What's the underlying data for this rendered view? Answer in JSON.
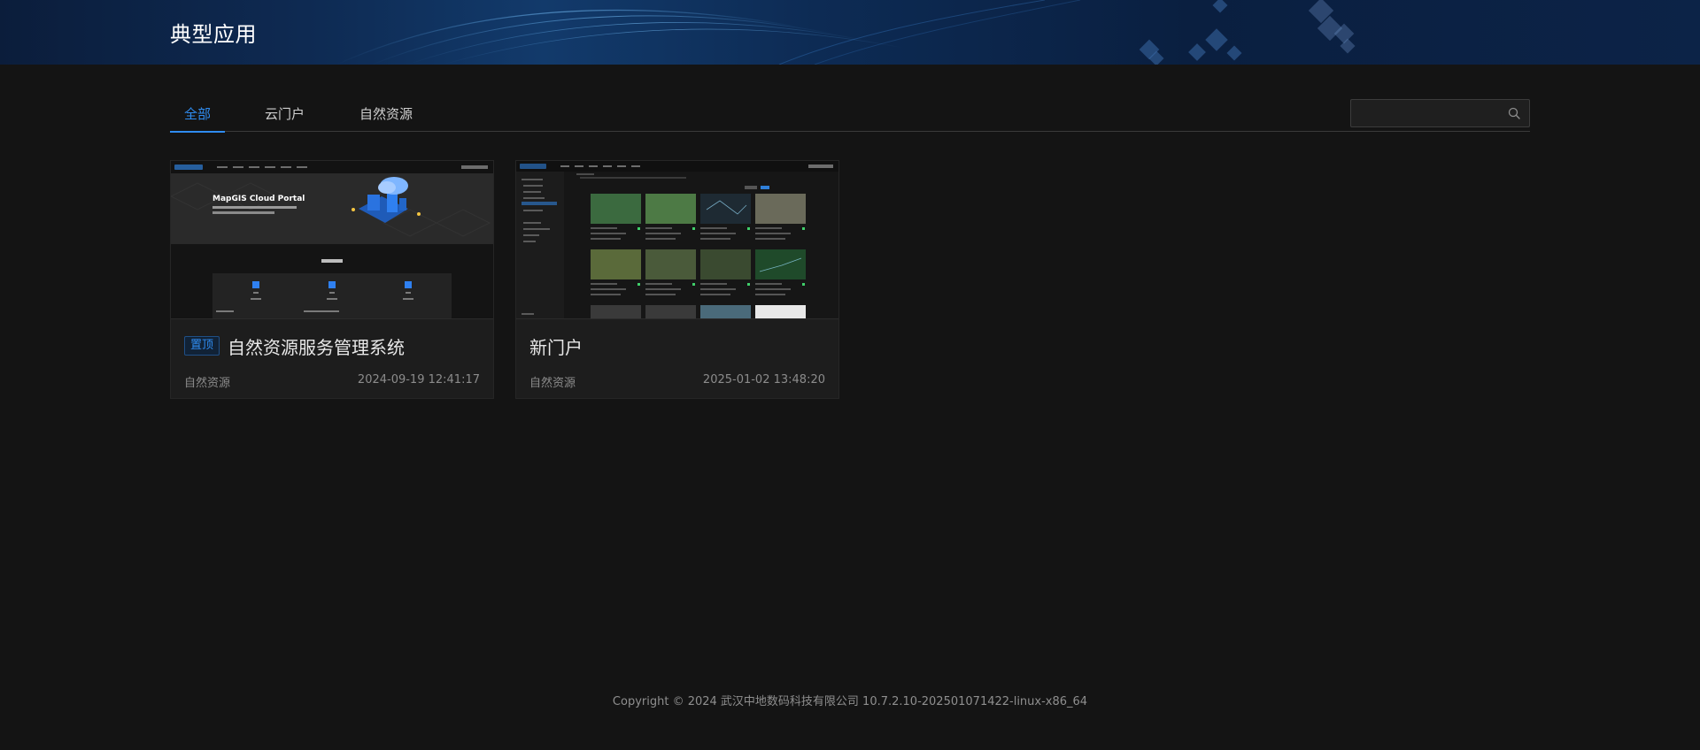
{
  "header": {
    "title": "典型应用"
  },
  "tabs": [
    {
      "label": "全部",
      "active": true
    },
    {
      "label": "云门户",
      "active": false
    },
    {
      "label": "自然资源",
      "active": false
    }
  ],
  "search": {
    "placeholder": "",
    "value": ""
  },
  "cards": [
    {
      "pinned_label": "置顶",
      "title": "自然资源服务管理系统",
      "category": "自然资源",
      "timestamp": "2024-09-19 12:41:17",
      "thumbnail": {
        "hero_title": "MapGIS Cloud Portal"
      }
    },
    {
      "title": "新门户",
      "category": "自然资源",
      "timestamp": "2025-01-02 13:48:20"
    }
  ],
  "footer": {
    "text": "Copyright © 2024 武汉中地数码科技有限公司 10.7.2.10-202501071422-linux-x86_64"
  },
  "colors": {
    "accent": "#2f8cf0",
    "background": "#141414",
    "card": "#1d1d1d"
  }
}
